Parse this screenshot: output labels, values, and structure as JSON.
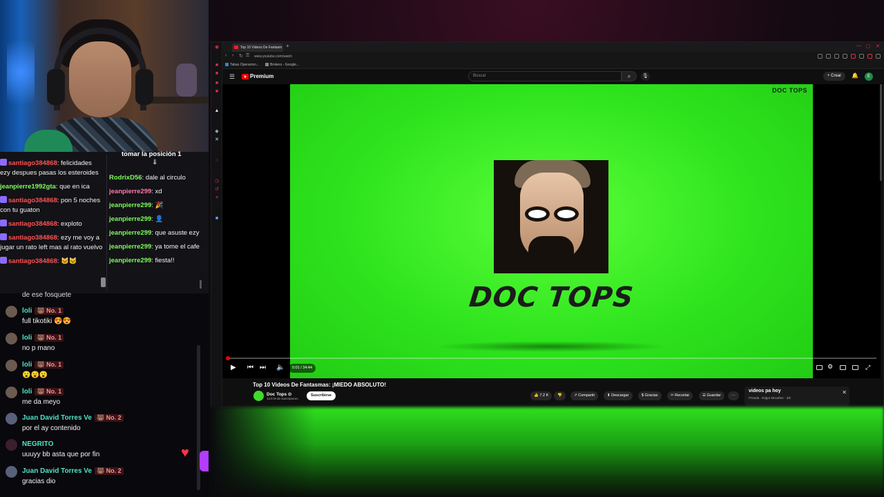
{
  "browser": {
    "tab_title": "Top 10 Videos De Fantasm",
    "url": "www.youtube.com/watch",
    "bookmarks": [
      "Tabas Operacion...",
      "Brokers - Google..."
    ]
  },
  "youtube": {
    "brand": "Premium",
    "search_placeholder": "Buscar",
    "create_label": "Crear",
    "avatar_initial": "E"
  },
  "video": {
    "watermark": "DOC TOPS",
    "logo_text": "DOC TOPS",
    "time": "0:01 / 34:44",
    "progress_fraction": 0.002,
    "title": "Top 10 Videos De Fantasmas: ¡MIEDO ABSOLUTO!",
    "channel": "Doc Tops ⊙",
    "subscribers": "13.6 M de suscriptores",
    "subscribe_label": "Suscribirse",
    "likes": "7.2 K",
    "share_label": "Compartir",
    "download_label": "Descargar",
    "thanks_label": "Gracias",
    "clip_label": "Recortar",
    "save_label": "Guardar",
    "more_label": "···"
  },
  "playlist": {
    "title": "videos pa hoy",
    "subtitle": "Privada · Edgar Mecalme · 3/6"
  },
  "chat_top": {
    "pinned_title": "tomar la posición 1",
    "left": [
      {
        "user": "santiago384868",
        "text": ": felicidades ezy despues pasas los esteroides",
        "color": "red"
      },
      {
        "user": "jeanpierre1992gta",
        "text": ": que en ica",
        "color": "green"
      },
      {
        "user": "santiago384868",
        "text": ": pon 5 noches con tu guaton",
        "color": "red"
      },
      {
        "user": "santiago384868",
        "text": ": exploto",
        "color": "red"
      },
      {
        "user": "santiago384868",
        "text": ": ezy me voy a jugar un rato left mas al rato vuelvo",
        "color": "red"
      },
      {
        "user": "santiago384868",
        "text": ": 🐱🐱",
        "color": "red"
      }
    ],
    "right": [
      {
        "user": "RodrixD56",
        "text": ": dale al circulo",
        "color": "green"
      },
      {
        "user": "jeanpierre299",
        "text": ": xd",
        "color": "pink"
      },
      {
        "user": "jeanpierre299",
        "text": ": 🎉",
        "color": "green"
      },
      {
        "user": "jeanpierre299",
        "text": ": 👤",
        "color": "green"
      },
      {
        "user": "jeanpierre299",
        "text": ": que asuste ezy",
        "color": "green"
      },
      {
        "user": "jeanpierre299",
        "text": ": ya tome el cafe",
        "color": "green"
      },
      {
        "user": "jeanpierre299",
        "text": ": fiesta!!",
        "color": "green"
      }
    ]
  },
  "chat_bottom": {
    "partial": "de ese fosquete",
    "messages": [
      {
        "user": "loli",
        "badge": "🐻 No. 1",
        "text": "full tikotiki 😍😍"
      },
      {
        "user": "loli",
        "badge": "🐻 No. 1",
        "text": "no p mano"
      },
      {
        "user": "loli",
        "badge": "🐻 No. 1",
        "text": "😮😮😮"
      },
      {
        "user": "loli",
        "badge": "🐻 No. 1",
        "text": "me da meyo"
      },
      {
        "user": "Juan David Torres Ve",
        "badge": "🐻 No. 2",
        "text": "por el ay contenido"
      },
      {
        "user": "NEGRITO",
        "badge": "",
        "text": "uuuyy bb asta que por fin"
      },
      {
        "user": "Juan David Torres Ve",
        "badge": "🐻 No. 2",
        "text": "gracias dio"
      }
    ]
  },
  "colors": {
    "youtube_red": "#ff0000",
    "video_green": "#2ee41d",
    "chat_red": "#ff5252",
    "chat_green": "#7dff5a",
    "chat_teal": "#4ee3c8"
  }
}
